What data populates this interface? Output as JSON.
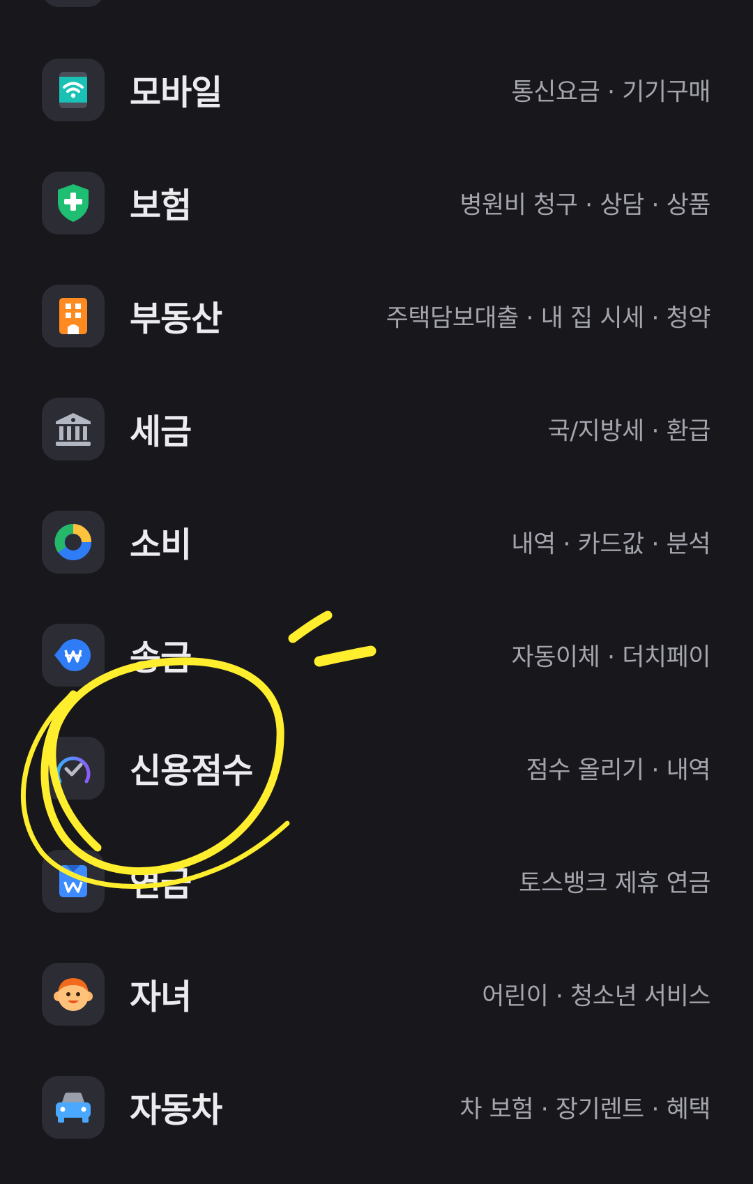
{
  "menu": {
    "items": [
      {
        "title": "모바일",
        "subtitle": "통신요금 · 기기구매",
        "icon": "wifi-phone-icon"
      },
      {
        "title": "보험",
        "subtitle": "병원비 청구 · 상담 · 상품",
        "icon": "shield-plus-icon"
      },
      {
        "title": "부동산",
        "subtitle": "주택담보대출 · 내 집 시세 · 청약",
        "icon": "building-icon"
      },
      {
        "title": "세금",
        "subtitle": "국/지방세 · 환급",
        "icon": "bank-icon"
      },
      {
        "title": "소비",
        "subtitle": "내역 · 카드값 · 분석",
        "icon": "donut-chart-icon"
      },
      {
        "title": "송금",
        "subtitle": "자동이체 · 더치페이",
        "icon": "won-transfer-icon"
      },
      {
        "title": "신용점수",
        "subtitle": "점수 올리기 · 내역",
        "icon": "credit-gauge-icon"
      },
      {
        "title": "연금",
        "subtitle": "토스뱅크 제휴 연금",
        "icon": "pension-icon"
      },
      {
        "title": "자녀",
        "subtitle": "어린이 · 청소년 서비스",
        "icon": "child-face-icon"
      },
      {
        "title": "자동차",
        "subtitle": "차 보험 · 장기렌트 · 혜택",
        "icon": "car-icon"
      }
    ]
  },
  "colors": {
    "background": "#17171c",
    "icon_tile": "#2c2c35",
    "title": "#ececef",
    "subtitle": "#a5a5ae",
    "highlight_scribble": "#ffee2e"
  }
}
